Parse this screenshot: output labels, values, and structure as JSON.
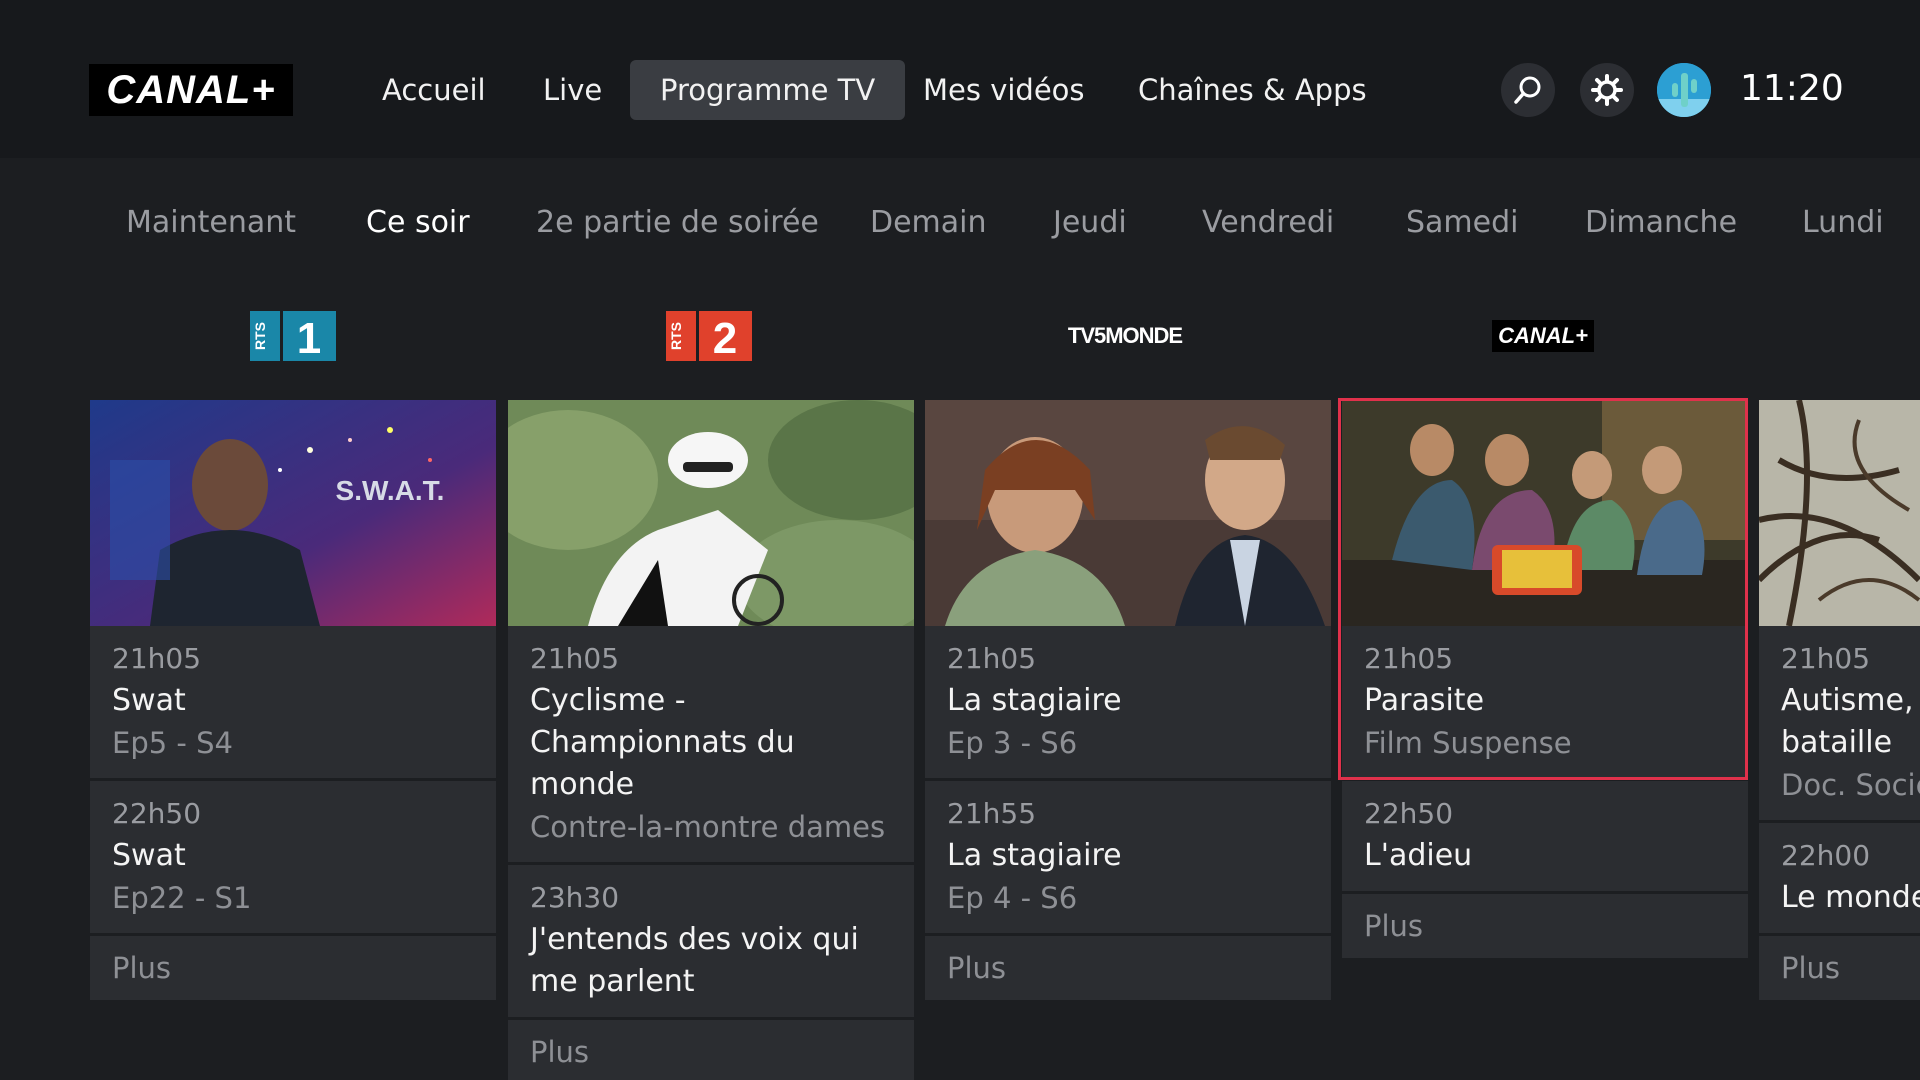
{
  "brand": {
    "logo_text": "CANAL+"
  },
  "nav": {
    "items": [
      {
        "label": "Accueil"
      },
      {
        "label": "Live"
      },
      {
        "label": "Programme TV"
      },
      {
        "label": "Mes vidéos"
      },
      {
        "label": "Chaînes & Apps"
      }
    ],
    "active": "Programme TV"
  },
  "header_icons": [
    "search-icon",
    "gear-icon",
    "avatar"
  ],
  "clock": "11:20",
  "day_tabs": {
    "items": [
      {
        "label": "Maintenant"
      },
      {
        "label": "Ce soir"
      },
      {
        "label": "2e partie de soirée"
      },
      {
        "label": "Demain"
      },
      {
        "label": "Jeudi"
      },
      {
        "label": "Vendredi"
      },
      {
        "label": "Samedi"
      },
      {
        "label": "Dimanche"
      },
      {
        "label": "Lundi"
      }
    ],
    "active": "Ce soir"
  },
  "channels": [
    {
      "logo_text": "RTS 1",
      "logo_color": "#1a87a8"
    },
    {
      "logo_text": "RTS 2",
      "logo_color": "#e0412c"
    },
    {
      "logo_text": "TV5MONDE",
      "logo_color": "#ffffff"
    },
    {
      "logo_text": "CANAL+",
      "logo_color": "#ffffff"
    },
    {
      "logo_text": "",
      "logo_color": "#ffffff"
    }
  ],
  "programs": [
    {
      "thumb_caption": "S.W.A.T.",
      "slots": [
        {
          "time": "21h05",
          "title": "Swat",
          "sub": "Ep5 - S4"
        },
        {
          "time": "22h50",
          "title": "Swat",
          "sub": "Ep22 - S1"
        }
      ],
      "more": "Plus"
    },
    {
      "thumb_caption": "",
      "slots": [
        {
          "time": "21h05",
          "title": "Cyclisme - Championnats du monde",
          "sub": "Contre-la-montre dames"
        },
        {
          "time": "23h30",
          "title": "J'entends des voix qui me parlent",
          "sub": ""
        }
      ],
      "more": "Plus"
    },
    {
      "thumb_caption": "",
      "slots": [
        {
          "time": "21h05",
          "title": "La stagiaire",
          "sub": "Ep 3 - S6"
        },
        {
          "time": "21h55",
          "title": "La stagiaire",
          "sub": "Ep 4 - S6"
        }
      ],
      "more": "Plus"
    },
    {
      "thumb_caption": "",
      "focused": true,
      "slots": [
        {
          "time": "21h05",
          "title": "Parasite",
          "sub": "Film Suspense"
        },
        {
          "time": "22h50",
          "title": "L'adieu",
          "sub": ""
        }
      ],
      "more": "Plus"
    },
    {
      "thumb_caption": "",
      "slots": [
        {
          "time": "21h05",
          "title": "Autisme, r bataille",
          "sub": "Doc. Socié"
        },
        {
          "time": "22h00",
          "title": "Le monde",
          "sub": ""
        }
      ],
      "more": "Plus"
    }
  ],
  "colors": {
    "background": "#1c1e21",
    "topbar": "#17191c",
    "cell": "#2b2d31",
    "focus_border": "#e0314b",
    "active_nav": "#3a3d42"
  }
}
